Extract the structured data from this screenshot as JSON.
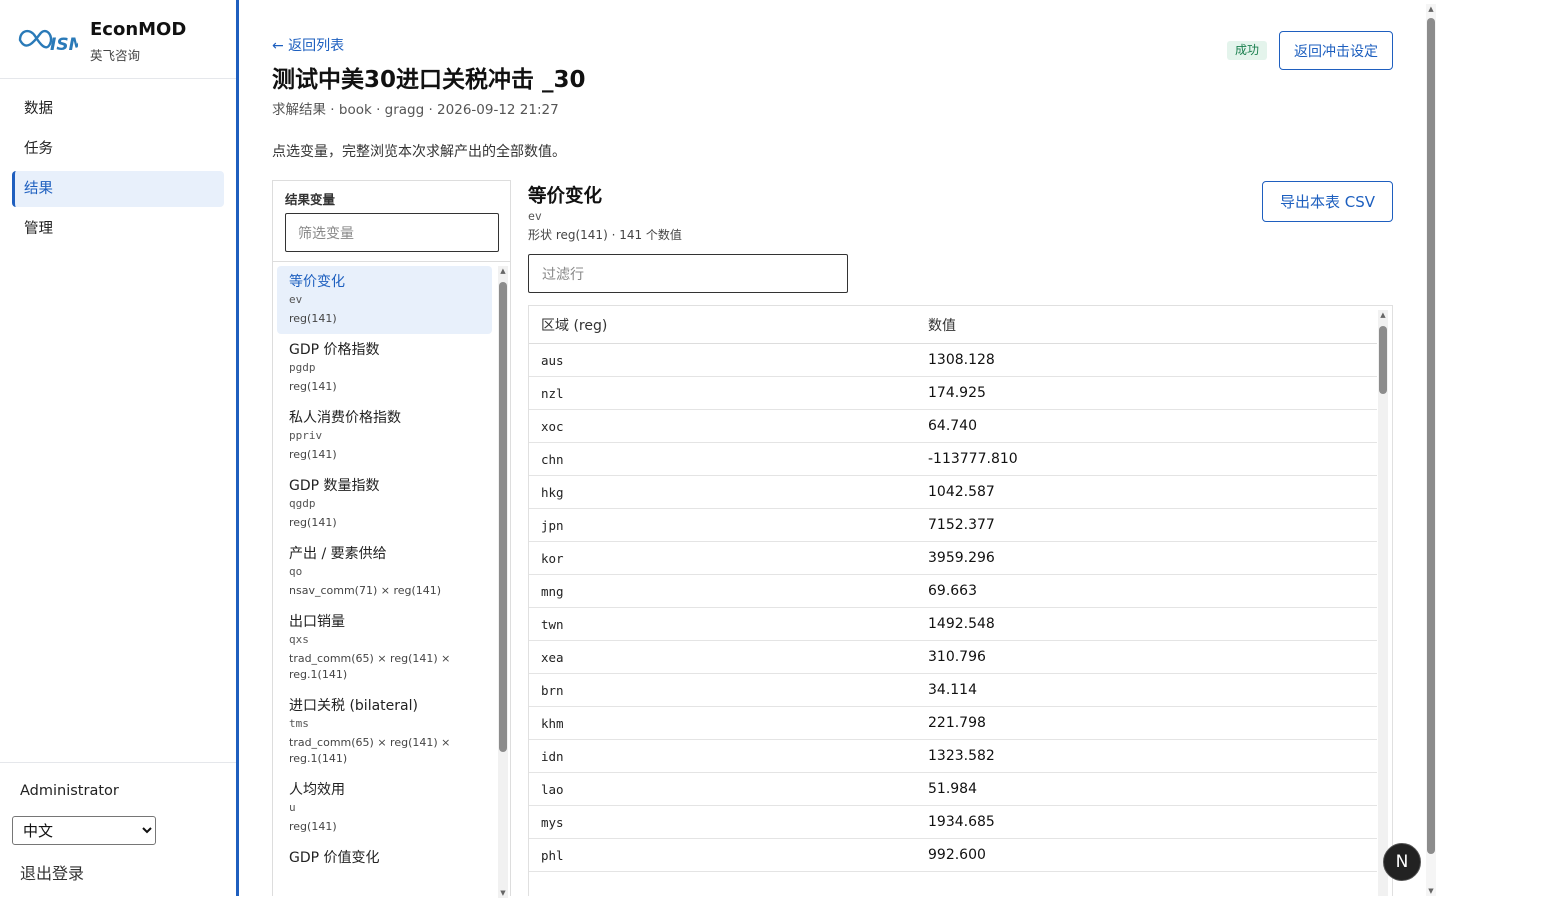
{
  "app": {
    "name": "EconMOD",
    "subtitle": "英飞咨询",
    "logo_text": "ISM"
  },
  "nav": {
    "items": [
      {
        "label": "数据",
        "active": false
      },
      {
        "label": "任务",
        "active": false
      },
      {
        "label": "结果",
        "active": true
      },
      {
        "label": "管理",
        "active": false
      }
    ]
  },
  "user": {
    "name": "Administrator",
    "language": "中文",
    "logout": "退出登录"
  },
  "header": {
    "back_link": "← 返回列表",
    "title": "测试中美30进口关税冲击 _30",
    "subtitle": "求解结果 · book · gragg · 2026-09-12 21:27",
    "status": "成功",
    "back_to_setup": "返回冲击设定",
    "intro": "点选变量，完整浏览本次求解产出的全部数值。"
  },
  "variables": {
    "panel_title": "结果变量",
    "filter_placeholder": "筛选变量",
    "items": [
      {
        "label": "等价变化",
        "code": "ev",
        "shape": "reg(141)"
      },
      {
        "label": "GDP 价格指数",
        "code": "pgdp",
        "shape": "reg(141)"
      },
      {
        "label": "私人消费价格指数",
        "code": "ppriv",
        "shape": "reg(141)"
      },
      {
        "label": "GDP 数量指数",
        "code": "qgdp",
        "shape": "reg(141)"
      },
      {
        "label": "产出 / 要素供给",
        "code": "qo",
        "shape": "nsav_comm(71) × reg(141)"
      },
      {
        "label": "出口销量",
        "code": "qxs",
        "shape": "trad_comm(65) × reg(141) × reg.1(141)"
      },
      {
        "label": "进口关税 (bilateral)",
        "code": "tms",
        "shape": "trad_comm(65) × reg(141) × reg.1(141)"
      },
      {
        "label": "人均效用",
        "code": "u",
        "shape": "reg(141)"
      },
      {
        "label": "GDP 价值变化",
        "code": "",
        "shape": ""
      }
    ]
  },
  "detail": {
    "title": "等价变化",
    "code": "ev",
    "shape_info": "形状 reg(141) · 141 个数值",
    "export_button": "导出本表 CSV",
    "row_filter_placeholder": "过滤行",
    "columns": [
      "区域 (reg)",
      "数值"
    ],
    "rows": [
      [
        "aus",
        "1308.128"
      ],
      [
        "nzl",
        "174.925"
      ],
      [
        "xoc",
        "64.740"
      ],
      [
        "chn",
        "-113777.810"
      ],
      [
        "hkg",
        "1042.587"
      ],
      [
        "jpn",
        "7152.377"
      ],
      [
        "kor",
        "3959.296"
      ],
      [
        "mng",
        "69.663"
      ],
      [
        "twn",
        "1492.548"
      ],
      [
        "xea",
        "310.796"
      ],
      [
        "brn",
        "34.114"
      ],
      [
        "khm",
        "221.798"
      ],
      [
        "idn",
        "1323.582"
      ],
      [
        "lao",
        "51.984"
      ],
      [
        "mys",
        "1934.685"
      ],
      [
        "phl",
        "992.600"
      ]
    ]
  },
  "fab": {
    "label": "N"
  }
}
